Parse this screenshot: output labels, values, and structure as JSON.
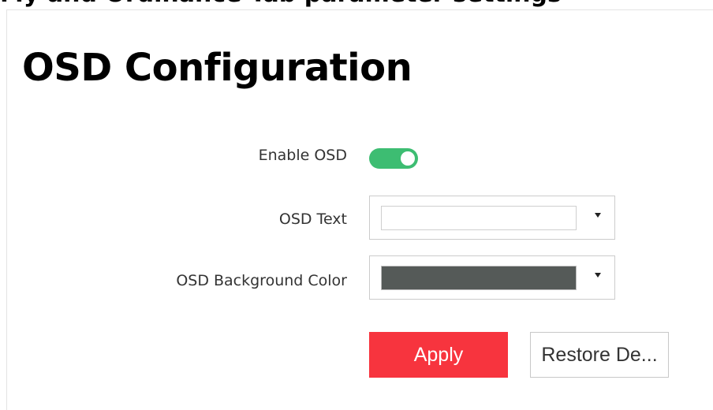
{
  "top_partial_text": "My and Ordinance Tab parameter settings",
  "page": {
    "title": "OSD Configuration"
  },
  "form": {
    "enable_osd": {
      "label": "Enable OSD",
      "state": "on",
      "on_color": "#3dbd72"
    },
    "osd_text": {
      "label": "OSD Text",
      "value": ""
    },
    "osd_background_color": {
      "label": "OSD Background Color",
      "selected_color": "#555a58"
    }
  },
  "buttons": {
    "apply_label": "Apply",
    "apply_color": "#f7343e",
    "restore_label": "Restore De..."
  },
  "icons": {
    "dropdown": "caret-down-icon"
  }
}
